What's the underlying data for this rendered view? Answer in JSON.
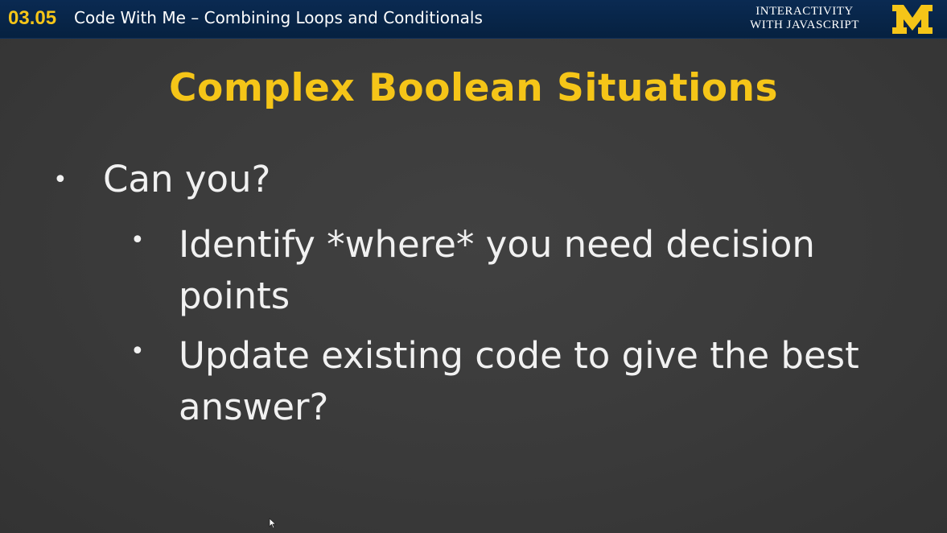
{
  "header": {
    "lesson_number": "03.05",
    "lesson_title": "Code With Me – Combining Loops and Conditionals",
    "course_line1": "INTERACTIVITY",
    "course_line2": "WITH JAVASCRIPT",
    "logo_letter": "M"
  },
  "slide": {
    "title": "Complex Boolean Situations",
    "bullets": [
      {
        "text": "Can you?",
        "children": [
          {
            "text": "Identify *where* you need decision points"
          },
          {
            "text": "Update existing code to give the best answer?"
          }
        ]
      }
    ]
  },
  "colors": {
    "header_bg": "#0a2a52",
    "accent_maize": "#f5c518",
    "slide_bg": "#3a3a3a",
    "text": "#f1f1f1"
  }
}
